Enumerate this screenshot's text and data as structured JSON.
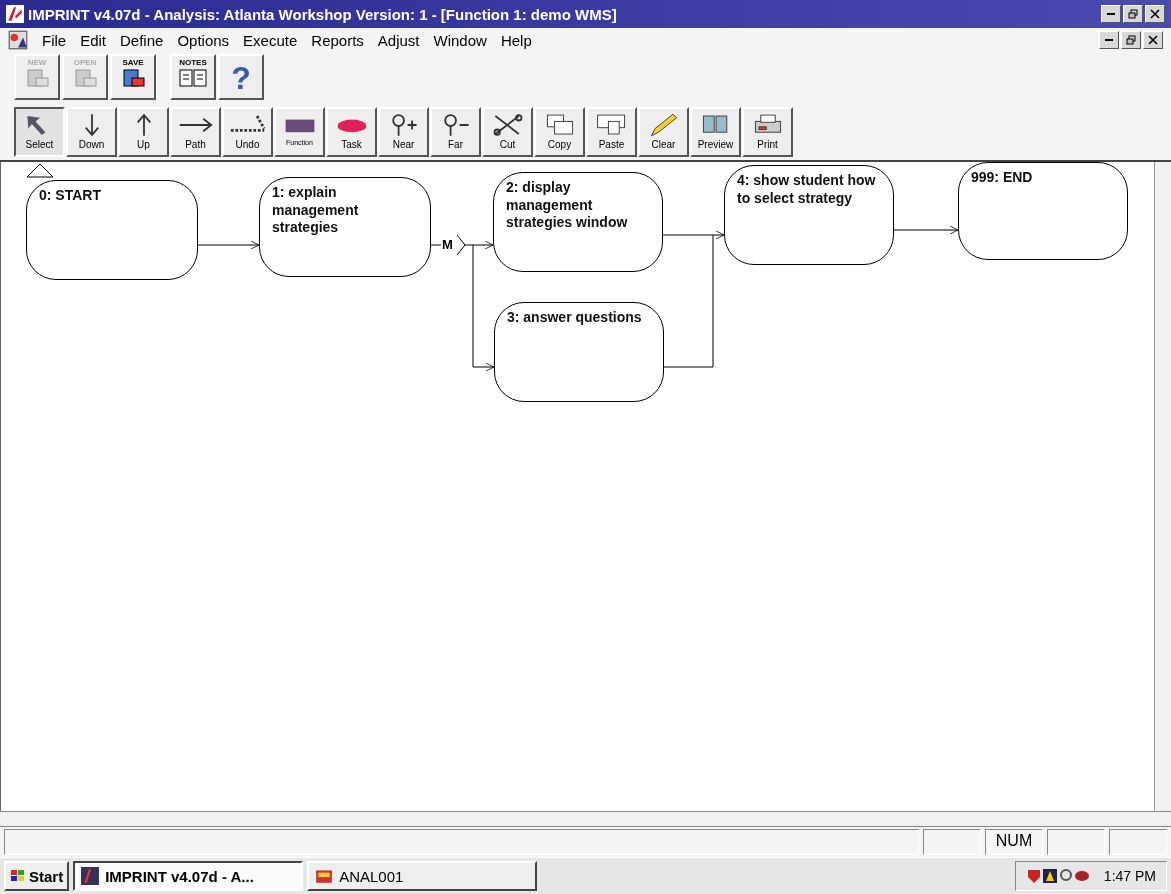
{
  "window": {
    "title": "IMPRINT v4.07d -  Analysis: Atlanta Workshop  Version: 1 - [Function 1: demo WMS]"
  },
  "menu": [
    "File",
    "Edit",
    "Define",
    "Options",
    "Execute",
    "Reports",
    "Adjust",
    "Window",
    "Help"
  ],
  "toolbar_top": [
    {
      "label": "NEW",
      "disabled": true
    },
    {
      "label": "OPEN",
      "disabled": true
    },
    {
      "label": "SAVE",
      "disabled": false
    },
    {
      "label": "NOTES",
      "disabled": false
    },
    {
      "label": "?",
      "disabled": false
    }
  ],
  "toolbar_tools": [
    {
      "label": "Select",
      "selected": true
    },
    {
      "label": "Down",
      "selected": false
    },
    {
      "label": "Up",
      "selected": false
    },
    {
      "label": "Path",
      "selected": false
    },
    {
      "label": "Undo",
      "selected": false
    },
    {
      "label": "Function",
      "selected": false
    },
    {
      "label": "Task",
      "selected": false
    },
    {
      "label": "Near",
      "selected": false
    },
    {
      "label": "Far",
      "selected": false
    },
    {
      "label": "Cut",
      "selected": false
    },
    {
      "label": "Copy",
      "selected": false
    },
    {
      "label": "Paste",
      "selected": false
    },
    {
      "label": "Clear",
      "selected": false
    },
    {
      "label": "Preview",
      "selected": false
    },
    {
      "label": "Print",
      "selected": false
    }
  ],
  "diagram": {
    "nodes": [
      {
        "label": "0: START"
      },
      {
        "label": "1: explain management strategies"
      },
      {
        "label": "2: display management strategies window"
      },
      {
        "label": "3: answer questions"
      },
      {
        "label": "4: show student how to select strategy"
      },
      {
        "label": "999: END"
      }
    ],
    "branch_label": "M"
  },
  "status_bar": {
    "indicators": [
      "NUM"
    ]
  },
  "taskbar": {
    "start": "Start",
    "tasks": [
      {
        "label": "IMPRINT v4.07d -  A...",
        "selected": true
      },
      {
        "label": "ANAL001",
        "selected": false
      }
    ],
    "clock": "1:47 PM"
  }
}
